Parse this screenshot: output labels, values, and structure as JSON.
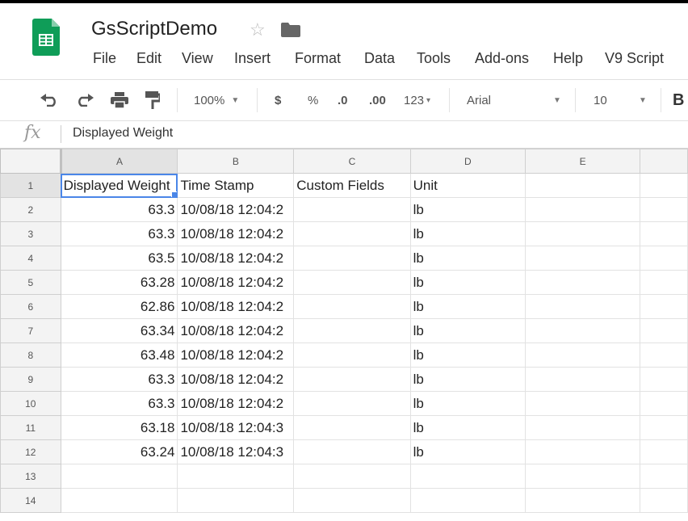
{
  "doc": {
    "title": "GsScriptDemo"
  },
  "menu": [
    "File",
    "Edit",
    "View",
    "Insert",
    "Format",
    "Data",
    "Tools",
    "Add-ons",
    "Help",
    "V9 Script"
  ],
  "toolbar": {
    "zoom": "100%",
    "currency": "$",
    "percent": "%",
    "decimal_decrease": ".0",
    "decimal_increase": ".00",
    "number_format": "123",
    "font": "Arial",
    "font_size": "10",
    "bold": "B"
  },
  "formula_bar": {
    "fx": "fx",
    "value": "Displayed Weight"
  },
  "columns": [
    "A",
    "B",
    "C",
    "D",
    "E",
    ""
  ],
  "rows": [
    {
      "n": "1",
      "a": "Displayed Weight",
      "b": "Time Stamp",
      "c": "Custom Fields",
      "d": "Unit",
      "e": ""
    },
    {
      "n": "2",
      "a": "63.3",
      "b": "10/08/18 12:04:2",
      "c": "",
      "d": "lb",
      "e": ""
    },
    {
      "n": "3",
      "a": "63.3",
      "b": "10/08/18 12:04:2",
      "c": "",
      "d": "lb",
      "e": ""
    },
    {
      "n": "4",
      "a": "63.5",
      "b": "10/08/18 12:04:2",
      "c": "",
      "d": "lb",
      "e": ""
    },
    {
      "n": "5",
      "a": "63.28",
      "b": "10/08/18 12:04:2",
      "c": "",
      "d": "lb",
      "e": ""
    },
    {
      "n": "6",
      "a": "62.86",
      "b": "10/08/18 12:04:2",
      "c": "",
      "d": "lb",
      "e": ""
    },
    {
      "n": "7",
      "a": "63.34",
      "b": "10/08/18 12:04:2",
      "c": "",
      "d": "lb",
      "e": ""
    },
    {
      "n": "8",
      "a": "63.48",
      "b": "10/08/18 12:04:2",
      "c": "",
      "d": "lb",
      "e": ""
    },
    {
      "n": "9",
      "a": "63.3",
      "b": "10/08/18 12:04:2",
      "c": "",
      "d": "lb",
      "e": ""
    },
    {
      "n": "10",
      "a": "63.3",
      "b": "10/08/18 12:04:2",
      "c": "",
      "d": "lb",
      "e": ""
    },
    {
      "n": "11",
      "a": "63.18",
      "b": "10/08/18 12:04:3",
      "c": "",
      "d": "lb",
      "e": ""
    },
    {
      "n": "12",
      "a": "63.24",
      "b": "10/08/18 12:04:3",
      "c": "",
      "d": "lb",
      "e": ""
    },
    {
      "n": "13",
      "a": "",
      "b": "",
      "c": "",
      "d": "",
      "e": ""
    },
    {
      "n": "14",
      "a": "",
      "b": "",
      "c": "",
      "d": "",
      "e": ""
    }
  ],
  "colors": {
    "sheets_green": "#0f9d58",
    "selection_blue": "#4a86e8"
  }
}
